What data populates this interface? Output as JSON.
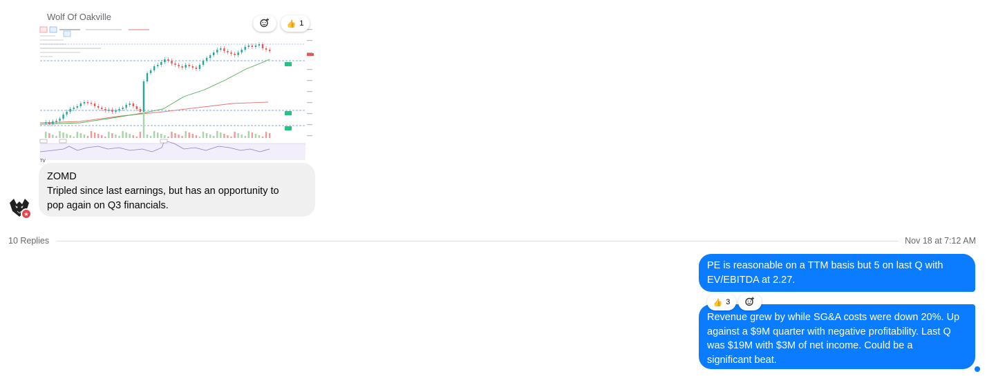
{
  "post": {
    "sender": "Wolf Of Oakville",
    "reactions": [
      {
        "icon": "add-reaction-icon",
        "count": ""
      },
      {
        "icon": "thumbs-up-icon",
        "emoji": "👍",
        "count": "1"
      }
    ],
    "message_lines": [
      "ZOMD",
      "Tripled since last earnings, but has an opportunity to",
      "pop again on Q3 financials."
    ],
    "avatar_icon": "wolf-avatar-icon"
  },
  "thread": {
    "replies_label": "10 Replies",
    "timestamp": "Nov 18 at 7:12 AM"
  },
  "replies": [
    {
      "lines": [
        "PE is reasonable on a TTM basis but 5 on last Q with",
        "EV/EBITDA at 2.27."
      ]
    },
    {
      "reactions": [
        {
          "icon": "thumbs-up-icon",
          "emoji": "👍",
          "count": "3"
        },
        {
          "icon": "add-reaction-icon",
          "count": ""
        }
      ],
      "lines": [
        "Revenue grew by while SG&A costs were down 20%. Up",
        "against a $9M quarter with negative profitability. Last Q",
        "was $19M with $3M of net income. Could be a",
        "significant beat."
      ]
    }
  ],
  "colors": {
    "outgoing_bubble": "#0a7cff",
    "incoming_bubble": "#f0f0f0",
    "candle_up": "#26a69a",
    "candle_down": "#ef5350"
  }
}
